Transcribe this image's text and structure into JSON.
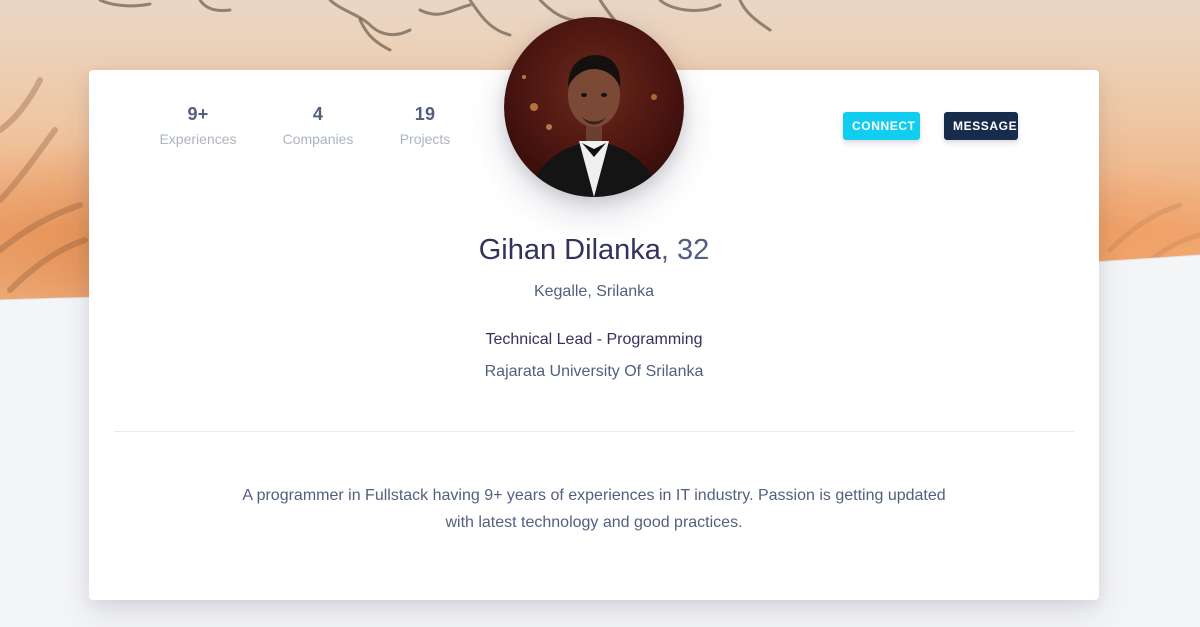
{
  "stats": [
    {
      "value": "9+",
      "label": "Experiences"
    },
    {
      "value": "4",
      "label": "Companies"
    },
    {
      "value": "19",
      "label": "Projects"
    }
  ],
  "buttons": {
    "connect": "CONNECT",
    "message": "MESSAGE"
  },
  "profile": {
    "name": "Gihan Dilanka",
    "age": ", 32",
    "location": "Kegalle, Srilanka",
    "title": "Technical Lead - Programming",
    "university": "Rajarata University Of Srilanka",
    "bio": "A programmer in Fullstack having 9+ years of experiences in IT industry. Passion is getting updated with latest technology and good practices."
  },
  "colors": {
    "connect_bg": "#11cdef",
    "message_bg": "#172b4d",
    "heading": "#32325d",
    "muted": "#adb5bd"
  }
}
